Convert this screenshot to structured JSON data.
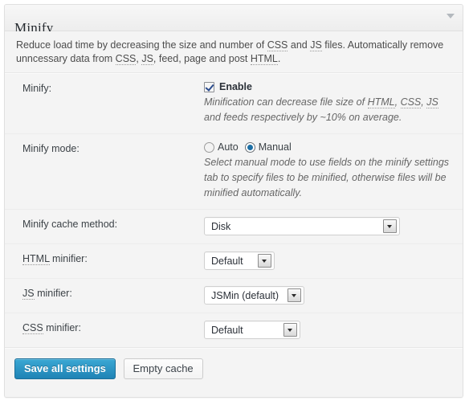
{
  "panel": {
    "title": "Minify",
    "toggle_icon": "chevron-down-icon",
    "intro_part1": "Reduce load time by decreasing the size and number of ",
    "intro_abbr1": "CSS",
    "intro_part2": " and ",
    "intro_abbr2": "JS",
    "intro_part3": " files. Automatically remove unncessary data from ",
    "intro_abbr3": "CSS",
    "intro_part4": ", ",
    "intro_abbr4": "JS",
    "intro_part5": ", feed, page and post ",
    "intro_abbr5": "HTML",
    "intro_part6": "."
  },
  "rows": {
    "minify": {
      "label": "Minify:",
      "checkbox_label": "Enable",
      "checked": true,
      "desc_a": "Minification can decrease file size of ",
      "desc_abbr1": "HTML",
      "desc_b": ", ",
      "desc_abbr2": "CSS",
      "desc_c": ", ",
      "desc_abbr3": "JS",
      "desc_d": " and feeds respectively by ~10% on average."
    },
    "minify_mode": {
      "label": "Minify mode:",
      "option_auto": "Auto",
      "option_manual": "Manual",
      "selected": "Manual",
      "desc": "Select manual mode to use fields on the minify settings tab to specify files to be minified, otherwise files will be minified automatically."
    },
    "cache_method": {
      "label": "Minify cache method:",
      "value": "Disk"
    },
    "html_minifier": {
      "label_abbr": "HTML",
      "label_rest": " minifier:",
      "value": "Default"
    },
    "js_minifier": {
      "label_abbr": "JS",
      "label_rest": " minifier:",
      "value": "JSMin (default)"
    },
    "css_minifier": {
      "label_abbr": "CSS",
      "label_rest": " minifier:",
      "value": "Default"
    }
  },
  "footer": {
    "save_label": "Save all settings",
    "empty_cache_label": "Empty cache"
  },
  "colors": {
    "primary_button": "#1f83b5",
    "checkbox_check": "#2a4b8d",
    "radio_dot": "#1d6fa5",
    "panel_bg": "#f4f4f4",
    "header_bg": "#ededed"
  }
}
